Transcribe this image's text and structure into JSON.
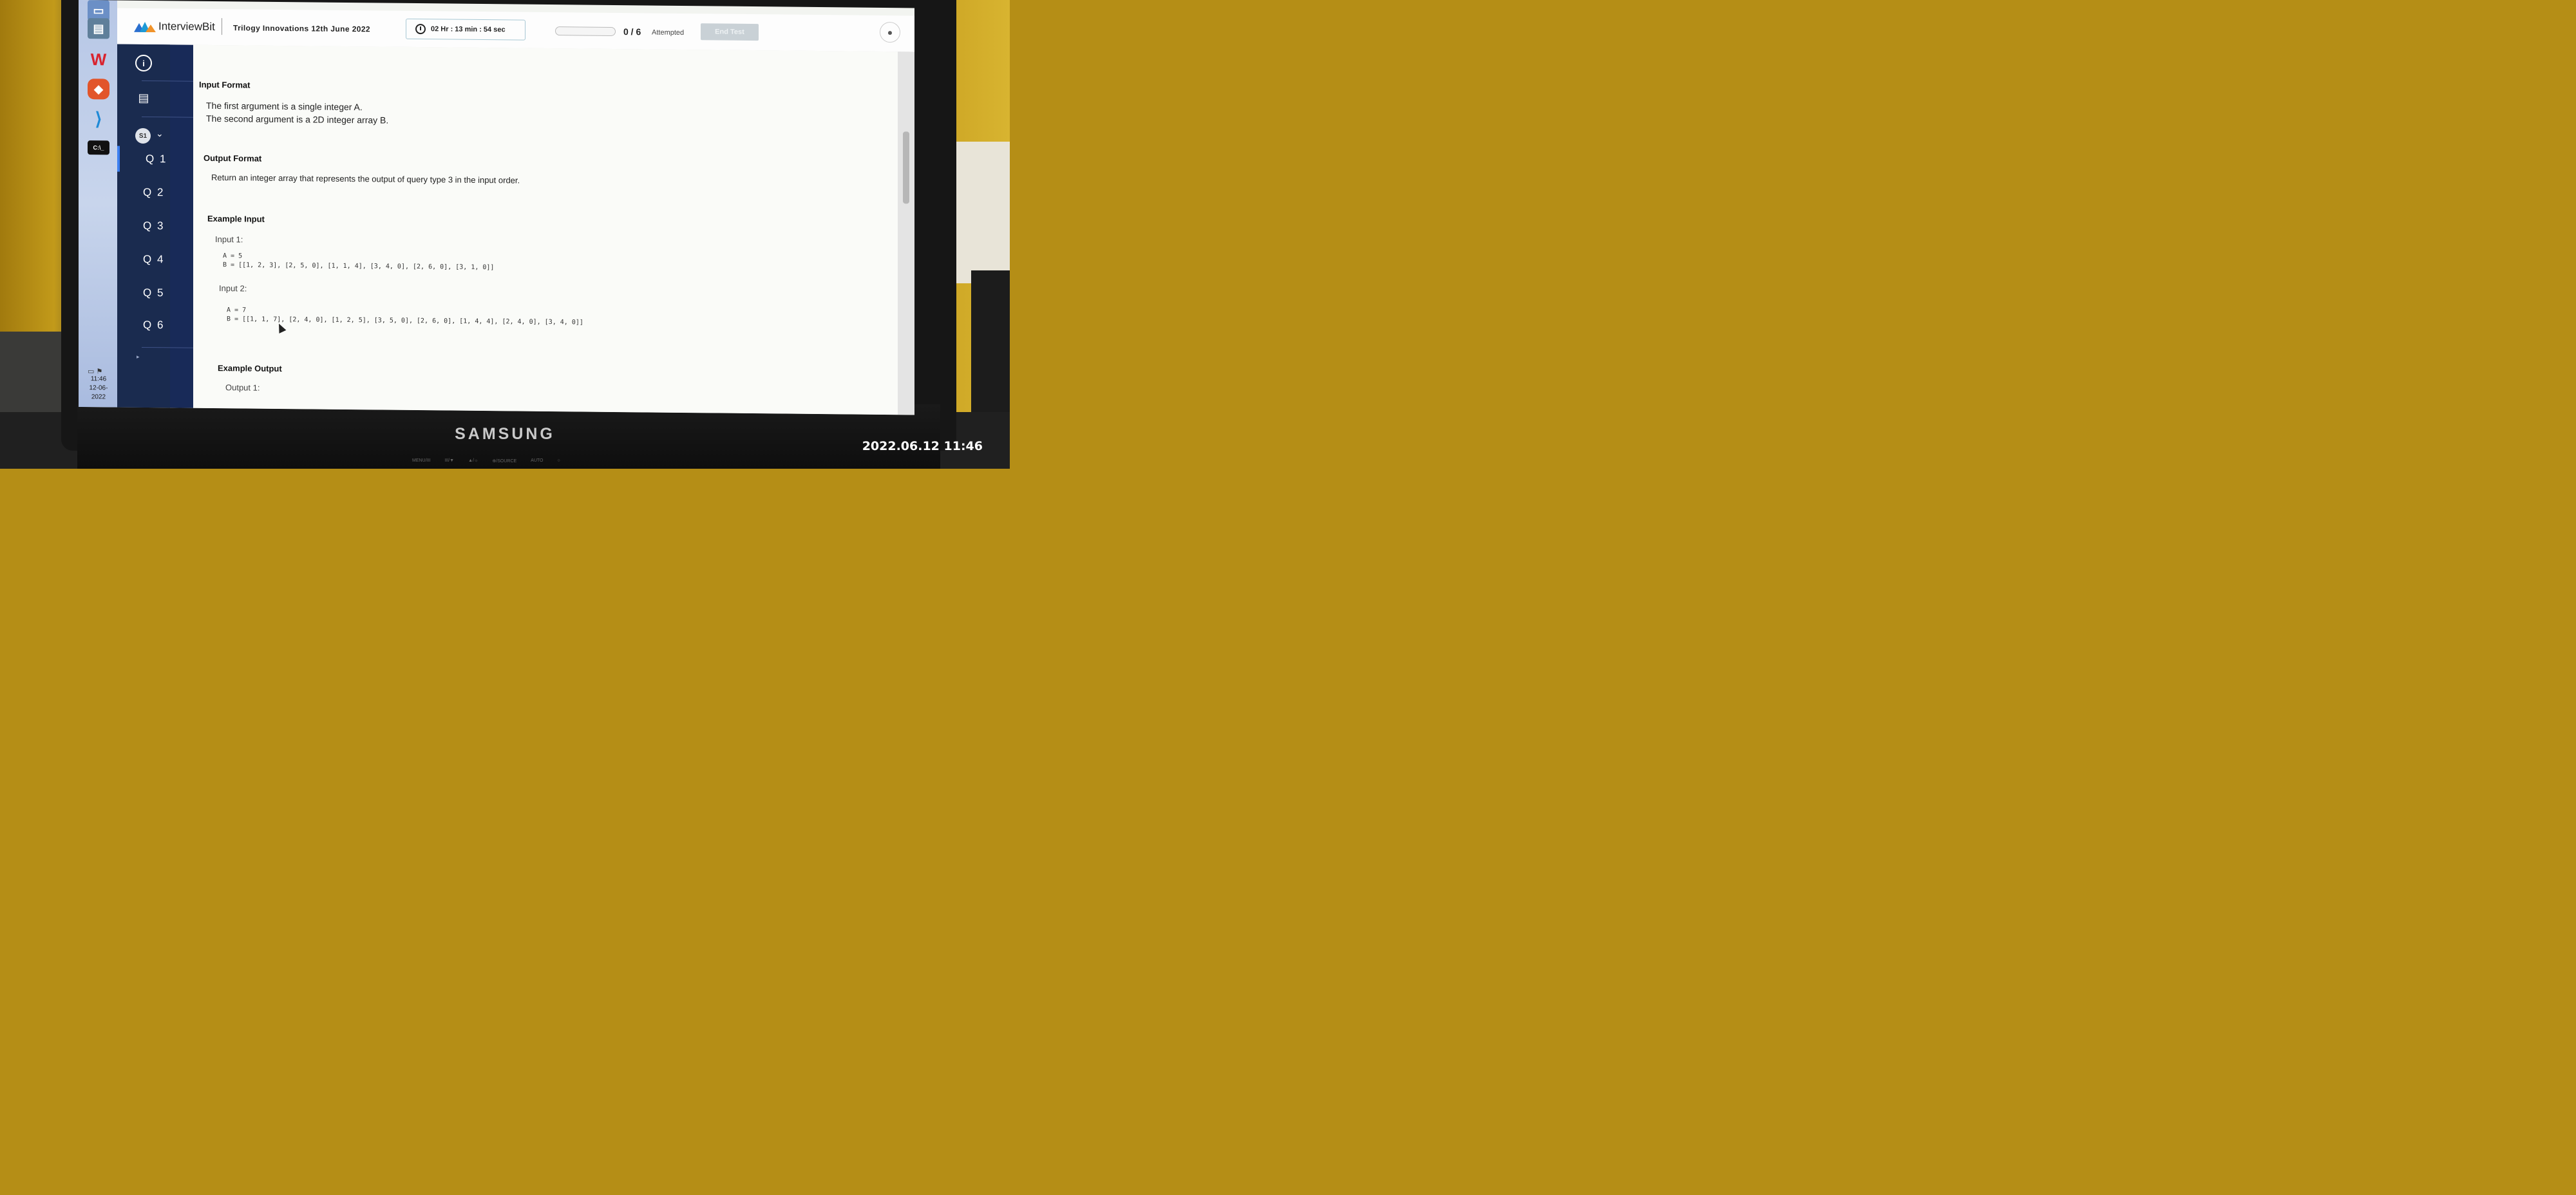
{
  "header": {
    "brand": "InterviewBit",
    "test_name": "Trilogy Innovations 12th June 2022",
    "timer": "02 Hr : 13 min : 54 sec",
    "progress": 0,
    "attempt_count": "0 / 6",
    "attempt_label": "Attempted",
    "end_test": "End Test"
  },
  "sidebar": {
    "section_badge": "S1",
    "questions": [
      "Q 1",
      "Q 2",
      "Q 3",
      "Q 4",
      "Q 5",
      "Q 6"
    ],
    "active_question": "Q 1"
  },
  "problem": {
    "input_format_title": "Input Format",
    "input_format_lines": [
      "The first argument is a single integer A.",
      "The second argument is a 2D integer array B."
    ],
    "output_format_title": "Output Format",
    "output_format_text": "Return an integer array that represents the output of query type 3 in the input order.",
    "example_input_title": "Example Input",
    "input1_label": "Input 1:",
    "input1_a": "A = 5",
    "input1_b": "B = [[1, 2, 3], [2, 5, 0], [1, 1, 4], [3, 4, 0], [2, 6, 0], [3, 1, 0]]",
    "input2_label": "Input 2:",
    "input2_a": "A = 7",
    "input2_b": "B = [[1, 1, 7], [2, 4, 0], [1, 2, 5], [3, 5, 0], [2, 6, 0], [1, 4, 4], [2, 4, 0], [3, 4, 0]]",
    "example_output_title": "Example Output",
    "output1_label": "Output 1:"
  },
  "taskbar": {
    "time": "11:46",
    "date": "12-06-2022",
    "icons": [
      "network-icon",
      "wps-office-icon",
      "brave-icon",
      "vscode-icon",
      "terminal-icon"
    ]
  },
  "monitor": {
    "brand": "SAMSUNG",
    "buttons": [
      "MENU/III",
      "III/▼",
      "▲/☼",
      "⊕/SOURCE",
      "AUTO",
      "○"
    ]
  },
  "photo_timestamp": "2022.06.12 11:46"
}
